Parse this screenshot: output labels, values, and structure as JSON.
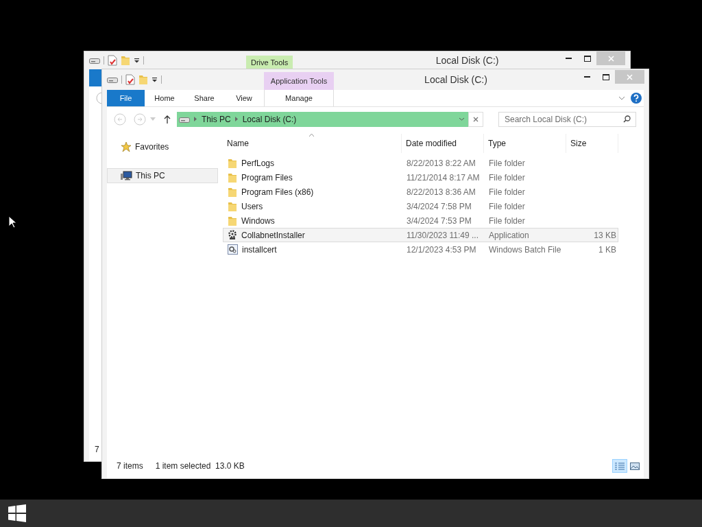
{
  "back_window": {
    "title": "Local Disk (C:)",
    "context_tab": "Drive Tools",
    "status_fragment": "7"
  },
  "window": {
    "title": "Local Disk (C:)",
    "context_tab": "Application Tools"
  },
  "ribbon_tabs": [
    {
      "label": "File",
      "kind": "file"
    },
    {
      "label": "Home",
      "kind": "plain"
    },
    {
      "label": "Share",
      "kind": "plain"
    },
    {
      "label": "View",
      "kind": "plain"
    },
    {
      "label": "Manage",
      "kind": "context"
    }
  ],
  "address": {
    "breadcrumbs": [
      "This PC",
      "Local Disk (C:)"
    ]
  },
  "search": {
    "placeholder": "Search Local Disk (C:)"
  },
  "nav": [
    {
      "label": "Favorites",
      "kind": "star",
      "selected": false
    },
    {
      "label": "This PC",
      "kind": "computer",
      "selected": true
    }
  ],
  "columns": [
    "Name",
    "Date modified",
    "Type",
    "Size"
  ],
  "files": [
    {
      "name": "PerfLogs",
      "date": "8/22/2013 8:22 AM",
      "type": "File folder",
      "kind": "folder",
      "selected": false
    },
    {
      "name": "Program Files",
      "date": "11/21/2014 8:17 AM",
      "type": "File folder",
      "kind": "folder",
      "selected": false
    },
    {
      "name": "Program Files (x86)",
      "date": "8/22/2013 8:36 AM",
      "type": "File folder",
      "kind": "folder",
      "selected": false
    },
    {
      "name": "Users",
      "date": "3/4/2024 7:58 PM",
      "type": "File folder",
      "kind": "folder",
      "selected": false
    },
    {
      "name": "Windows",
      "date": "3/4/2024 7:53 PM",
      "type": "File folder",
      "kind": "folder",
      "selected": false
    },
    {
      "name": "CollabnetInstaller",
      "date": "11/30/2023 11:49 ...",
      "type": "Application",
      "size": "13 KB",
      "kind": "app",
      "selected": true
    },
    {
      "name": "installcert",
      "date": "12/1/2023 4:53 PM",
      "type": "Windows Batch File",
      "size": "1 KB",
      "kind": "batch",
      "selected": false
    }
  ],
  "status": {
    "count": "7 items",
    "selection": "1 item selected  13.0 KB"
  },
  "views": [
    {
      "kind": "details",
      "selected": true
    },
    {
      "kind": "tiles",
      "selected": false
    }
  ]
}
